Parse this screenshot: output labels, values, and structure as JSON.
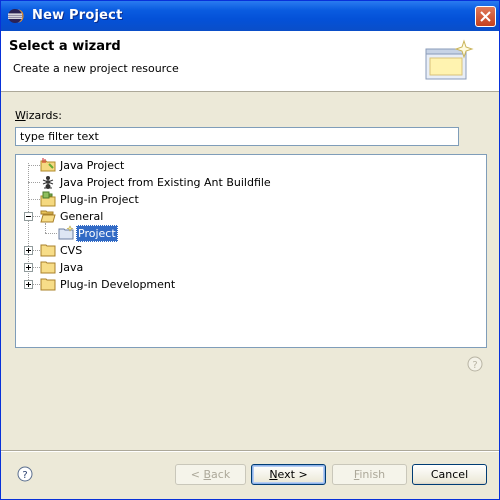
{
  "window": {
    "title": "New Project"
  },
  "banner": {
    "heading": "Select a wizard",
    "description": "Create a new project resource"
  },
  "wizards": {
    "label_mnemonic": "W",
    "label_rest": "izards:",
    "filter_value": "type filter text"
  },
  "tree": {
    "items": [
      {
        "label": "Java Project",
        "icon": "java-project-icon"
      },
      {
        "label": "Java Project from Existing Ant Buildfile",
        "icon": "ant-icon"
      },
      {
        "label": "Plug-in Project",
        "icon": "plugin-project-icon"
      },
      {
        "label": "General",
        "icon": "folder-open-icon",
        "expanded": true
      },
      {
        "label": "Project",
        "icon": "project-icon",
        "selected": true
      },
      {
        "label": "CVS",
        "icon": "folder-icon",
        "expanded": false
      },
      {
        "label": "Java",
        "icon": "folder-icon",
        "expanded": false
      },
      {
        "label": "Plug-in Development",
        "icon": "folder-icon",
        "expanded": false
      }
    ]
  },
  "buttons": {
    "back_prefix": "< ",
    "back_mnemonic": "B",
    "back_rest": "ack",
    "next_mnemonic": "N",
    "next_rest": "ext >",
    "finish_mnemonic": "F",
    "finish_rest": "inish",
    "cancel": "Cancel"
  },
  "colors": {
    "title_bar": "#0a5ce0",
    "selection": "#316ac5",
    "dialog_bg": "#ece9d8"
  }
}
